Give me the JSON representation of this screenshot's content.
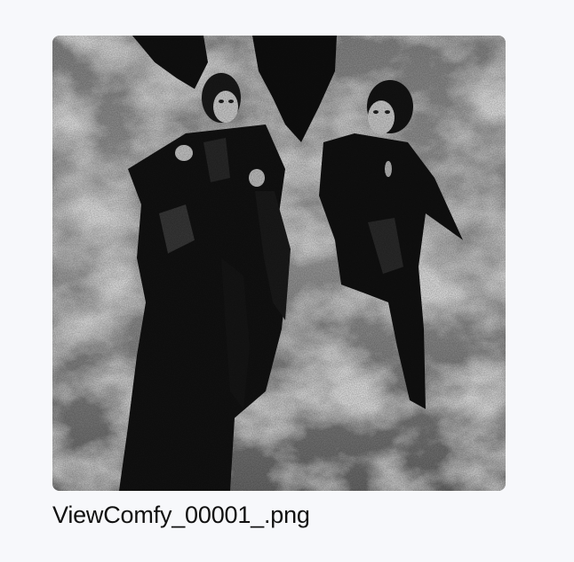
{
  "gallery": {
    "items": [
      {
        "filename": "ViewComfy_00001_.png",
        "thumbnail_icon": "image-thumbnail-icon"
      }
    ]
  }
}
